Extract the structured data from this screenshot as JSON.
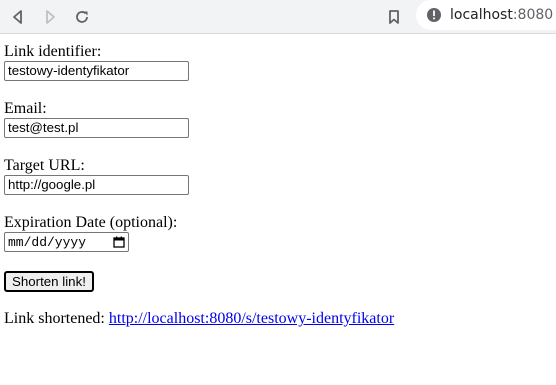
{
  "browser": {
    "url_host": "localhost",
    "url_port": ":8080"
  },
  "form": {
    "identifier": {
      "label": "Link identifier:",
      "value": "testowy-identyfikator"
    },
    "email": {
      "label": "Email:",
      "value": "test@test.pl"
    },
    "target_url": {
      "label": "Target URL:",
      "value": "http://google.pl"
    },
    "expiration": {
      "label": "Expiration Date (optional):",
      "placeholder": "mm/dd/yyyy"
    },
    "submit_label": "Shorten link!"
  },
  "result": {
    "prefix": "Link shortened:",
    "link": "http://localhost:8080/s/testowy-identyfikator"
  },
  "icons": {
    "back": "back-arrow-icon",
    "forward": "forward-arrow-icon",
    "reload": "reload-icon",
    "bookmark": "bookmark-icon",
    "info": "info-icon",
    "calendar": "calendar-icon"
  }
}
